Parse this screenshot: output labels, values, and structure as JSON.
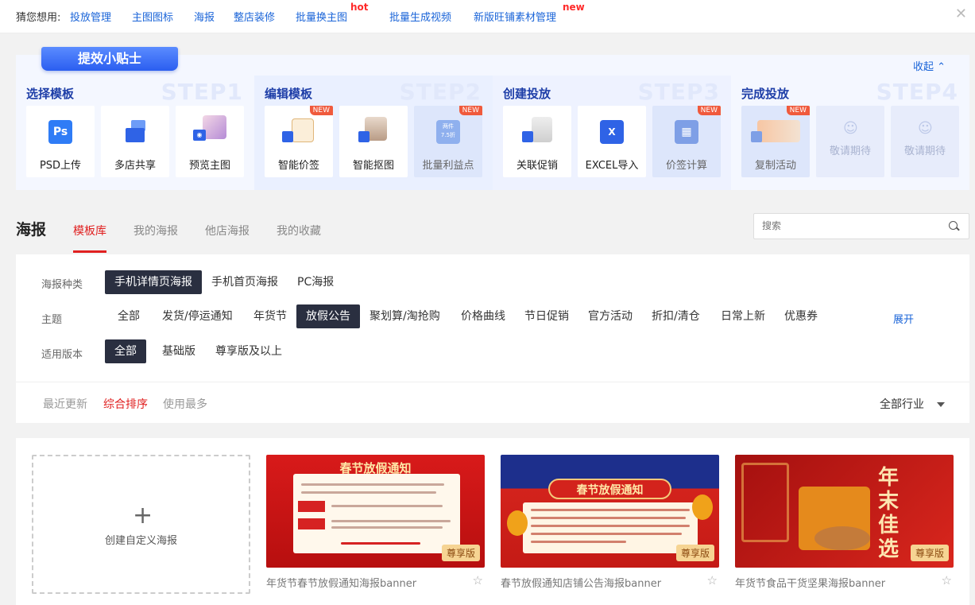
{
  "topbar": {
    "prefix": "猜您想用:",
    "links": [
      "投放管理",
      "主图图标",
      "海报",
      "整店装修",
      "批量换主图",
      "批量生成视频",
      "新版旺铺素材管理"
    ],
    "hot": "hot",
    "new": "new",
    "close": "✕"
  },
  "tips": {
    "badge": "提效小贴士",
    "collapse": "收起",
    "steps": [
      {
        "title": "选择模板",
        "num": "STEP1",
        "cards": [
          "PSD上传",
          "多店共享",
          "预览主图"
        ]
      },
      {
        "title": "编辑模板",
        "num": "STEP2",
        "cards": [
          "智能价签",
          "智能抠图",
          "批量利益点"
        ]
      },
      {
        "title": "创建投放",
        "num": "STEP3",
        "cards": [
          "关联促销",
          "EXCEL导入",
          "价签计算"
        ]
      },
      {
        "title": "完成投放",
        "num": "STEP4",
        "cards": [
          "复制活动",
          "敬请期待",
          "敬请期待"
        ]
      }
    ],
    "new_tag": "NEW",
    "ps_text": "Ps",
    "batch_text_1": "两件",
    "batch_text_2": "7.5折"
  },
  "section": {
    "title": "海报",
    "tabs": [
      "模板库",
      "我的海报",
      "他店海报",
      "我的收藏"
    ],
    "search_placeholder": "搜索"
  },
  "filters": {
    "type_label": "海报种类",
    "types": [
      "手机详情页海报",
      "手机首页海报",
      "PC海报"
    ],
    "theme_label": "主题",
    "themes": [
      "全部",
      "发货/停运通知",
      "年货节",
      "放假公告",
      "聚划算/淘抢购",
      "价格曲线",
      "节日促销",
      "官方活动",
      "折扣/清仓",
      "日常上新",
      "优惠券"
    ],
    "expand": "展开",
    "version_label": "适用版本",
    "versions": [
      "全部",
      "基础版",
      "尊享版及以上"
    ],
    "sorts": [
      "最近更新",
      "综合排序",
      "使用最多"
    ],
    "industry": "全部行业"
  },
  "gallery": {
    "create_label": "创建自定义海报",
    "posters": [
      {
        "caption": "年货节春节放假通知海报banner",
        "title": "春节放假通知",
        "vip": "尊享版"
      },
      {
        "caption": "春节放假通知店铺公告海报banner",
        "title": "春节放假通知",
        "vip": "尊享版"
      },
      {
        "caption": "年货节食品干货坚果海报banner",
        "title": "年末佳选",
        "vip": "尊享版"
      }
    ]
  },
  "colors": {
    "accent_red": "#e02020",
    "link_blue": "#1a64d8",
    "selected_dark": "#2a2f40"
  }
}
